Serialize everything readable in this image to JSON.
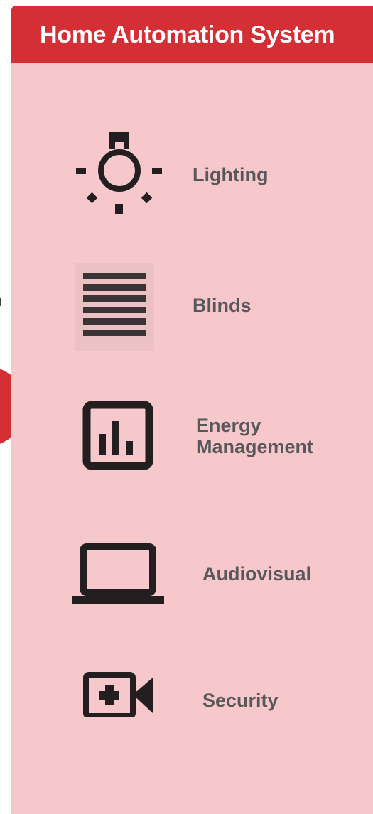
{
  "panel": {
    "title": "Home Automation System",
    "background_color": "#f6c7cb",
    "header_color": "#d32f35"
  },
  "left_fragment": {
    "text_top": "n",
    "text_bottom": "‘"
  },
  "items": [
    {
      "label": "Lighting",
      "icon": "light-bulb-icon"
    },
    {
      "label": "Blinds",
      "icon": "blinds-icon"
    },
    {
      "label": "Energy\nManagement",
      "icon": "energy-chart-icon"
    },
    {
      "label": "Audiovisual",
      "icon": "laptop-icon"
    },
    {
      "label": "Security",
      "icon": "security-camera-icon"
    }
  ]
}
